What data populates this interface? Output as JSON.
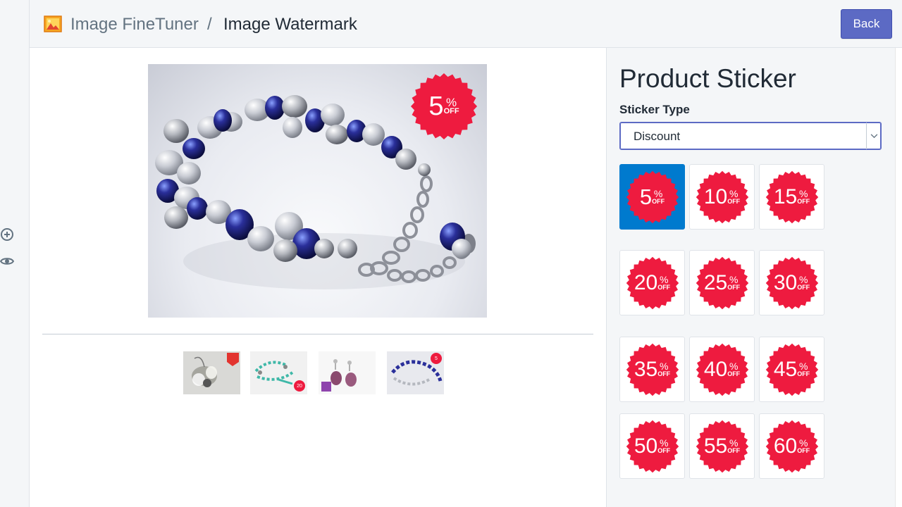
{
  "header": {
    "app_name": "Image FineTuner",
    "separator": "/",
    "page_title": "Image Watermark",
    "back_label": "Back"
  },
  "rail": {
    "icons": [
      "plus-circle-icon",
      "eye-icon"
    ]
  },
  "preview": {
    "image": "bracelet-photo",
    "sticker": {
      "number": "5",
      "pct": "%",
      "off": "OFF"
    }
  },
  "thumbnails": [
    {
      "name": "thumb-earrings-crystal"
    },
    {
      "name": "thumb-earrings-turquoise",
      "badge": "20"
    },
    {
      "name": "thumb-earrings-amethyst"
    },
    {
      "name": "thumb-bracelet-blue",
      "badge": "5"
    }
  ],
  "panel": {
    "title": "Product Sticker",
    "sticker_type_label": "Sticker Type",
    "sticker_type_value": "Discount",
    "sticker_percent": "%",
    "sticker_off": "OFF",
    "stickers": [
      "5",
      "10",
      "15",
      "20",
      "25",
      "30",
      "35",
      "40",
      "45",
      "50",
      "55",
      "60"
    ],
    "selected_index": 0
  },
  "colors": {
    "accent": "#5c6ac4",
    "selected_tile": "#007ace",
    "sticker_red": "#ee1b3f",
    "background": "#f4f6f8"
  }
}
